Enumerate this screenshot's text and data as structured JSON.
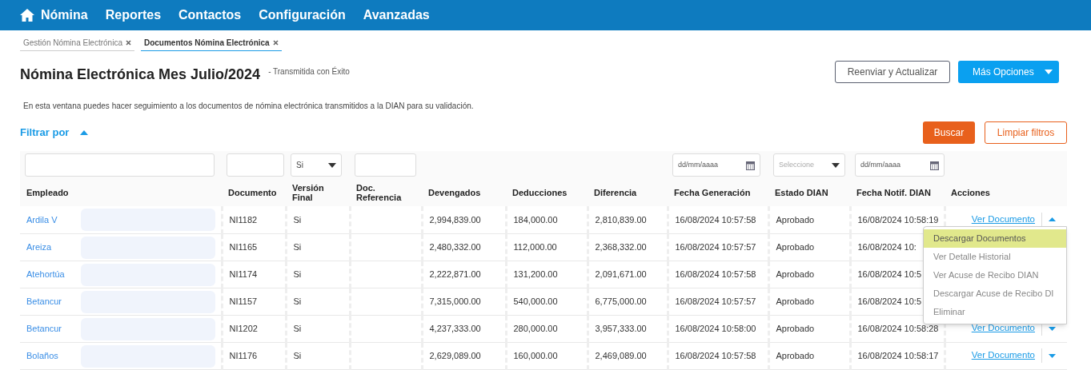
{
  "nav": {
    "items": [
      "Nómina",
      "Reportes",
      "Contactos",
      "Configuración",
      "Avanzadas"
    ]
  },
  "tabs": [
    {
      "label": "Gestión Nómina Electrónica",
      "selected": false
    },
    {
      "label": "Documentos Nómina Electrónica",
      "selected": true
    }
  ],
  "title": "Nómina Electrónica Mes Julio/2024",
  "subtitle": "- Transmitida con Éxito",
  "buttons": {
    "resend": "Reenviar y Actualizar",
    "more": "Más Opciones",
    "search": "Buscar",
    "clear": "Limpiar filtros"
  },
  "description": "En esta ventana puedes hacer seguimiento a los documentos de nómina electrónica transmitidos a la DIAN para su validación.",
  "filter": {
    "label": "Filtrar por",
    "expanded": true
  },
  "table": {
    "columns": [
      {
        "label": "Empleado",
        "filter": {
          "kind": "text"
        }
      },
      {
        "label": "Documento",
        "filter": {
          "kind": "text"
        }
      },
      {
        "label": "Versión Final",
        "filter": {
          "kind": "select",
          "value": "Si"
        }
      },
      {
        "label": "Doc. Referencia",
        "filter": {
          "kind": "text"
        }
      },
      {
        "label": "Devengados"
      },
      {
        "label": "Deducciones"
      },
      {
        "label": "Diferencia"
      },
      {
        "label": "Fecha Generación",
        "filter": {
          "kind": "date",
          "placeholder": "dd/mm/aaaa"
        }
      },
      {
        "label": "Estado DIAN",
        "filter": {
          "kind": "select",
          "placeholder": "Seleccione"
        }
      },
      {
        "label": "Fecha Notif. DIAN",
        "filter": {
          "kind": "date",
          "placeholder": "dd/mm/aaaa"
        }
      },
      {
        "label": "Acciones"
      }
    ],
    "rows": [
      {
        "empleado": "Ardila V",
        "documento": "NI1182",
        "version": "Si",
        "devengados": "2,994,839.00",
        "deducciones": "184,000.00",
        "diferencia": "2,810,839.00",
        "fecha_gen": "16/08/2024 10:57:58",
        "estado": "Aprobado",
        "fecha_notif": "16/08/2024 10:58:19",
        "action": "Ver Documento",
        "expanded": true
      },
      {
        "empleado": "Areiza",
        "documento": "NI1165",
        "version": "Si",
        "devengados": "2,480,332.00",
        "deducciones": "112,000.00",
        "diferencia": "2,368,332.00",
        "fecha_gen": "16/08/2024 10:57:57",
        "estado": "Aprobado",
        "fecha_notif": "16/08/2024 10:"
      },
      {
        "empleado": "Atehortúa",
        "documento": "NI1174",
        "version": "Si",
        "devengados": "2,222,871.00",
        "deducciones": "131,200.00",
        "diferencia": "2,091,671.00",
        "fecha_gen": "16/08/2024 10:57:58",
        "estado": "Aprobado",
        "fecha_notif": "16/08/2024 10:5"
      },
      {
        "empleado": "Betancur",
        "documento": "NI1157",
        "version": "Si",
        "devengados": "7,315,000.00",
        "deducciones": "540,000.00",
        "diferencia": "6,775,000.00",
        "fecha_gen": "16/08/2024 10:57:57",
        "estado": "Aprobado",
        "fecha_notif": "16/08/2024 10:5"
      },
      {
        "empleado": "Betancur",
        "documento": "NI1202",
        "version": "Si",
        "devengados": "4,237,333.00",
        "deducciones": "280,000.00",
        "diferencia": "3,957,333.00",
        "fecha_gen": "16/08/2024 10:58:00",
        "estado": "Aprobado",
        "fecha_notif": "16/08/2024 10:58:28",
        "action": "Ver Documento",
        "expanded": false
      },
      {
        "empleado": "Bolaños",
        "documento": "NI1176",
        "version": "Si",
        "devengados": "2,629,089.00",
        "deducciones": "160,000.00",
        "diferencia": "2,469,089.00",
        "fecha_gen": "16/08/2024 10:57:58",
        "estado": "Aprobado",
        "fecha_notif": "16/08/2024 10:58:17",
        "action": "Ver Documento",
        "expanded": false
      }
    ]
  },
  "menu": {
    "items": [
      {
        "label": "Descargar Documentos",
        "selected": true
      },
      {
        "label": "Ver Detalle Historial",
        "selected": false
      },
      {
        "label": "Ver Acuse de Recibo DIAN",
        "selected": false
      },
      {
        "label": "Descargar Acuse de Recibo DI",
        "selected": false
      },
      {
        "label": "Eliminar",
        "selected": false
      }
    ]
  }
}
